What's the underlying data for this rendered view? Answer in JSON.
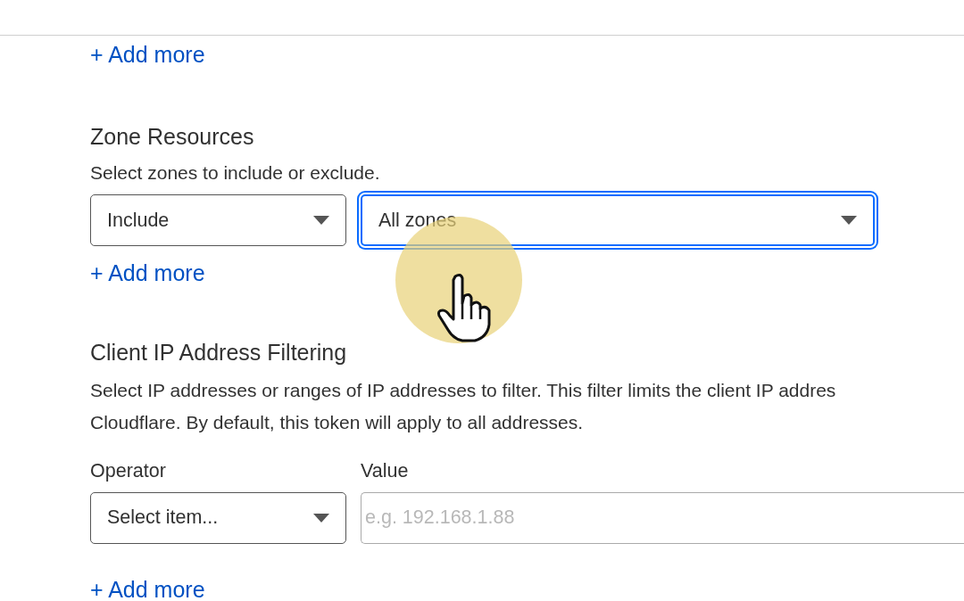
{
  "top_link": {
    "label": "+ Add more"
  },
  "zone_resources": {
    "title": "Zone Resources",
    "description": "Select zones to include or exclude.",
    "selects": [
      {
        "value": "Include",
        "focused": false
      },
      {
        "value": "All zones",
        "focused": true
      }
    ],
    "add_more": "+ Add more"
  },
  "client_ip_filtering": {
    "title": "Client IP Address Filtering",
    "description_lines": [
      "Select IP addresses or ranges of IP addresses to filter. This filter limits the client IP addres",
      "Cloudflare. By default, this token will apply to all addresses."
    ],
    "fields": [
      {
        "kind": "select",
        "label": "Operator",
        "value": "Select item..."
      },
      {
        "kind": "text",
        "label": "Value",
        "placeholder": "e.g. 192.168.1.88"
      }
    ],
    "add_more": "+ Add more"
  }
}
